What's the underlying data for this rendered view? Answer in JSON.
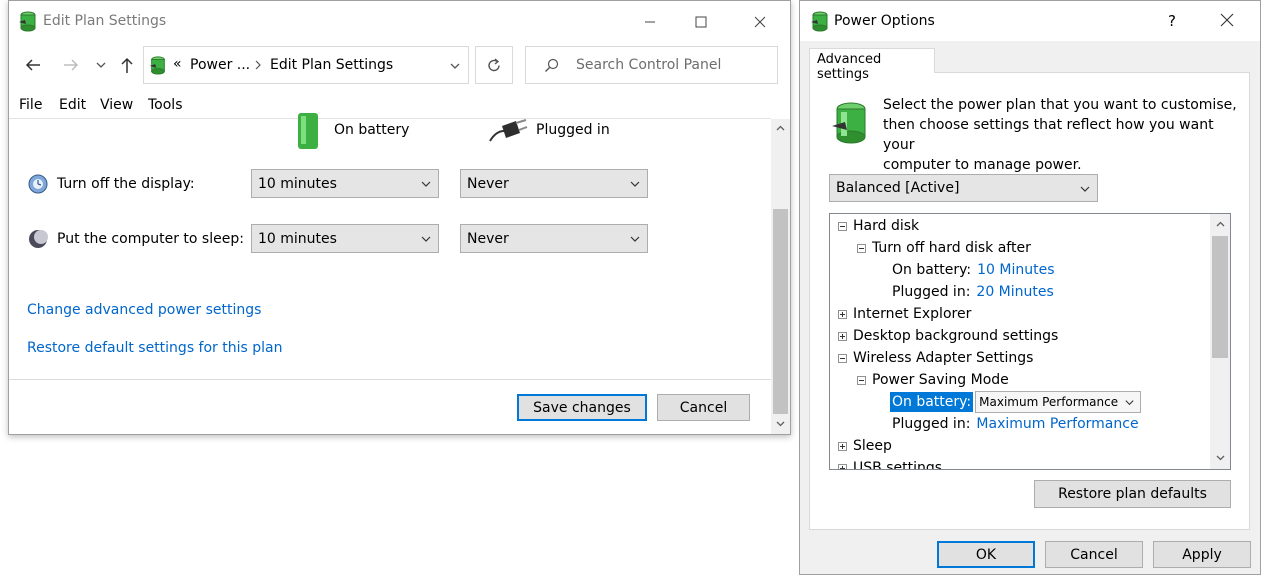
{
  "left_window": {
    "title": "Edit Plan Settings",
    "breadcrumb": {
      "separator": "«",
      "parent": "Power ...",
      "current": "Edit Plan Settings"
    },
    "search_placeholder": "Search Control Panel",
    "menu": [
      "File",
      "Edit",
      "View",
      "Tools"
    ],
    "column_headers": {
      "battery": "On battery",
      "plugged": "Plugged in"
    },
    "settings": [
      {
        "label": "Turn off the display:",
        "battery_value": "10 minutes",
        "plugged_value": "Never"
      },
      {
        "label": "Put the computer to sleep:",
        "battery_value": "10 minutes",
        "plugged_value": "Never"
      }
    ],
    "links": {
      "advanced": "Change advanced power settings",
      "restore": "Restore default settings for this plan"
    },
    "buttons": {
      "save": "Save changes",
      "cancel": "Cancel"
    }
  },
  "right_window": {
    "title": "Power Options",
    "help_glyph": "?",
    "tab": "Advanced settings",
    "description_lines": [
      "Select the power plan that you want to customise,",
      "then choose settings that reflect how you want your",
      "computer to manage power."
    ],
    "plan_selected": "Balanced [Active]",
    "tree": {
      "hard_disk": "Hard disk",
      "turn_off_hdd": "Turn off hard disk after",
      "hdd_battery_label": "On battery:",
      "hdd_battery_value": "10 Minutes",
      "hdd_plugged_label": "Plugged in:",
      "hdd_plugged_value": "20 Minutes",
      "internet_explorer": "Internet Explorer",
      "desktop_background": "Desktop background settings",
      "wireless_adapter": "Wireless Adapter Settings",
      "power_saving_mode": "Power Saving Mode",
      "psm_battery_label": "On battery:",
      "psm_battery_value": "Maximum Performance",
      "psm_plugged_label": "Plugged in:",
      "psm_plugged_value": "Maximum Performance",
      "sleep": "Sleep",
      "usb_settings": "USB settings"
    },
    "buttons": {
      "restore_plan": "Restore plan defaults",
      "ok": "OK",
      "cancel": "Cancel",
      "apply": "Apply"
    }
  },
  "colors": {
    "link": "#0066cc",
    "accent_focus": "#0078d7",
    "selection": "#0078d7",
    "battery_green": "#3cb043"
  }
}
